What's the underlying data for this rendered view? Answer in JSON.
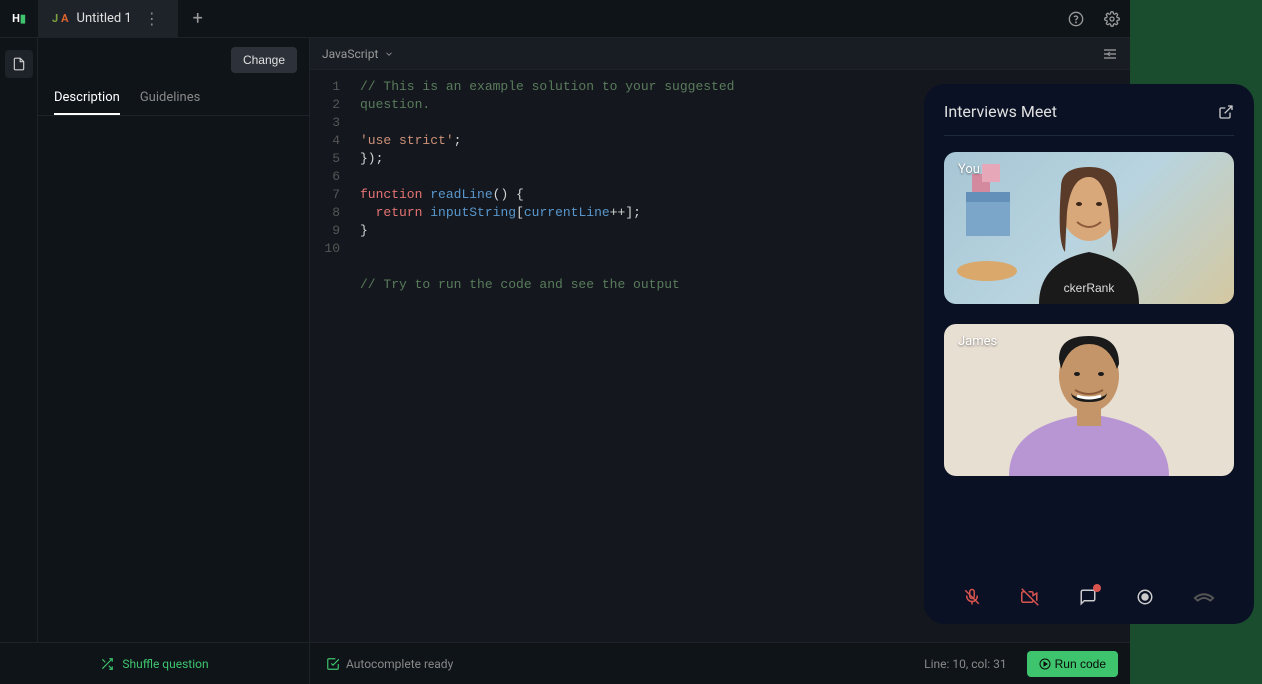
{
  "titlebar": {
    "logo_text": "H",
    "tab_title": "Untitled 1",
    "tab_icon_j": "J",
    "tab_icon_a": "A"
  },
  "sidebar": {
    "change_btn": "Change",
    "tabs": [
      "Description",
      "Guidelines"
    ]
  },
  "editor": {
    "language": "JavaScript",
    "lines": [
      {
        "n": "1",
        "spans": [
          {
            "cls": "c-comment",
            "t": "// This is an example solution to your suggested"
          }
        ]
      },
      {
        "n": "2",
        "spans": [
          {
            "cls": "c-comment",
            "t": "question."
          }
        ]
      },
      {
        "n": "3",
        "spans": []
      },
      {
        "n": "4",
        "spans": [
          {
            "cls": "c-string",
            "t": "'use strict'"
          },
          {
            "cls": "c-punct",
            "t": ";"
          }
        ]
      },
      {
        "n": "5",
        "spans": [
          {
            "cls": "c-punct",
            "t": "});"
          }
        ]
      },
      {
        "n": "6",
        "spans": []
      },
      {
        "n": "7",
        "spans": [
          {
            "cls": "c-keyword",
            "t": "function"
          },
          {
            "cls": "c-punct",
            "t": " "
          },
          {
            "cls": "c-func",
            "t": "readLine"
          },
          {
            "cls": "c-punct",
            "t": "() {"
          }
        ]
      },
      {
        "n": "8",
        "spans": [
          {
            "cls": "c-punct",
            "t": "  "
          },
          {
            "cls": "c-keyword",
            "t": "return"
          },
          {
            "cls": "c-punct",
            "t": " "
          },
          {
            "cls": "c-var",
            "t": "inputString"
          },
          {
            "cls": "c-punct",
            "t": "["
          },
          {
            "cls": "c-var",
            "t": "currentLine"
          },
          {
            "cls": "c-op",
            "t": "++"
          },
          {
            "cls": "c-punct",
            "t": "];"
          }
        ]
      },
      {
        "n": "9",
        "spans": [
          {
            "cls": "c-punct",
            "t": "}"
          }
        ]
      },
      {
        "n": "10",
        "spans": []
      }
    ],
    "extra_comment": "// Try to run the code and see the output"
  },
  "bottombar": {
    "shuffle": "Shuffle question",
    "autocomplete": "Autocomplete ready",
    "cursor": "Line: 10, col: 31",
    "run": "Run code"
  },
  "meet": {
    "title": "Interviews Meet",
    "participants": [
      {
        "label": "You"
      },
      {
        "label": "James"
      }
    ]
  }
}
